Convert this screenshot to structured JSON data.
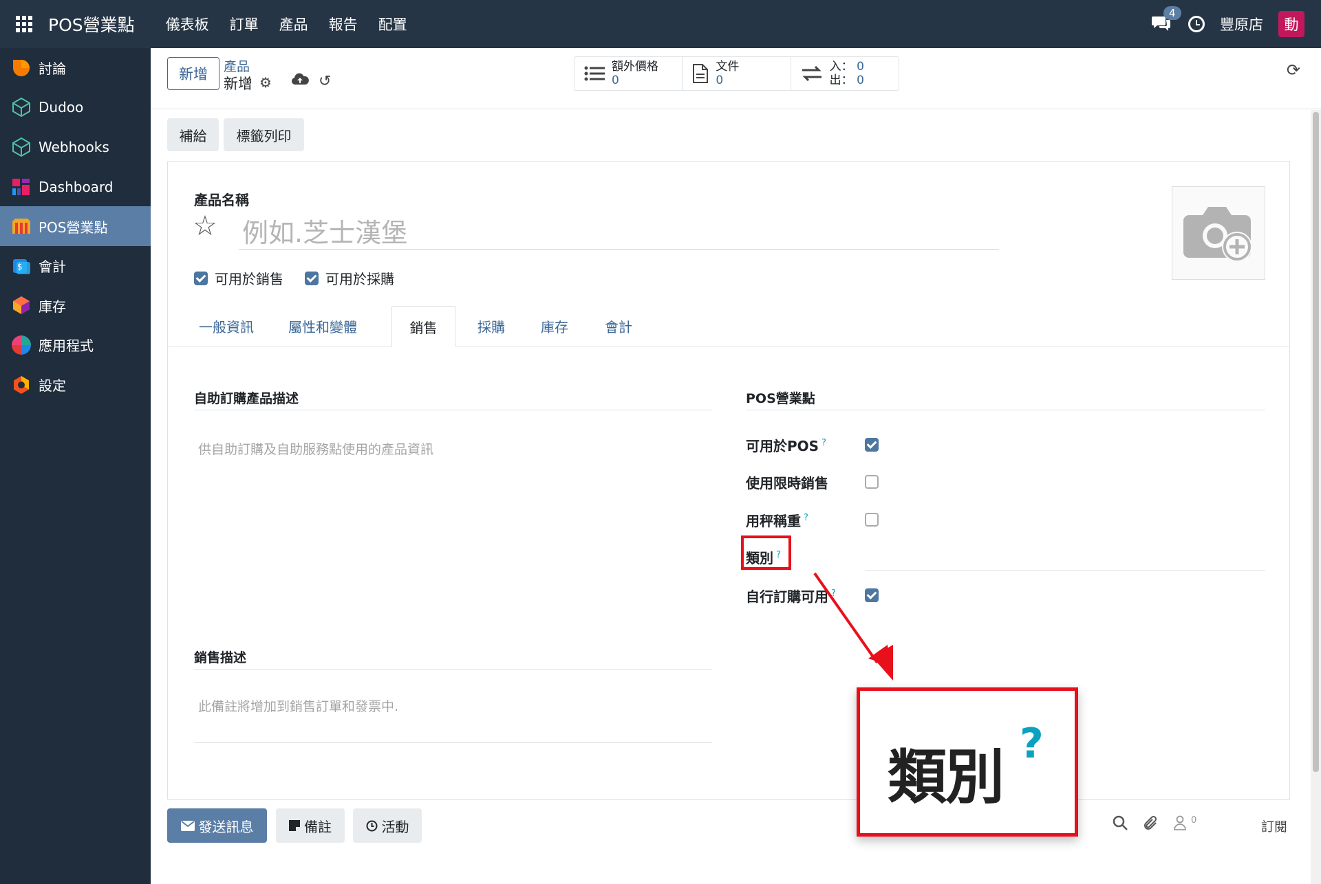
{
  "topbar": {
    "brand": "POS營業點",
    "menu": [
      "儀表板",
      "訂單",
      "產品",
      "報告",
      "配置"
    ],
    "chat_count": "4",
    "company": "豐原店",
    "avatar_initial": "動"
  },
  "sidebar": {
    "items": [
      {
        "label": "討論",
        "icon": "discuss-icon"
      },
      {
        "label": "Dudoo",
        "icon": "cube-icon"
      },
      {
        "label": "Webhooks",
        "icon": "cube-icon"
      },
      {
        "label": "Dashboard",
        "icon": "dashboard-icon"
      },
      {
        "label": "POS營業點",
        "icon": "pos-icon"
      },
      {
        "label": "會計",
        "icon": "accounting-icon"
      },
      {
        "label": "庫存",
        "icon": "inventory-icon"
      },
      {
        "label": "應用程式",
        "icon": "apps-icon"
      },
      {
        "label": "設定",
        "icon": "settings-icon"
      }
    ],
    "active": "POS營業點"
  },
  "control": {
    "new_label": "新增",
    "breadcrumb_parent": "產品",
    "breadcrumb_current": "新增",
    "stat_buttons": [
      {
        "label": "額外價格",
        "value": "0"
      },
      {
        "label": "文件",
        "value": "0"
      },
      {
        "in_label": "入：",
        "in_value": "0",
        "out_label": "出：",
        "out_value": "0"
      }
    ]
  },
  "actions": [
    "補給",
    "標籤列印"
  ],
  "form": {
    "name_label": "產品名稱",
    "name_placeholder": "例如.芝士漢堡",
    "can_sell_label": "可用於銷售",
    "can_purchase_label": "可用於採購",
    "tabs": [
      "一般資訊",
      "屬性和變體",
      "銷售",
      "採購",
      "庫存",
      "會計"
    ],
    "active_tab": "銷售",
    "self_order_section": "自助訂購產品描述",
    "self_order_placeholder": "供自助訂購及自助服務點使用的產品資訊",
    "sales_desc_section": "銷售描述",
    "sales_desc_placeholder": "此備註將增加到銷售訂單和發票中.",
    "pos_section": "POS營業點",
    "pos_fields": [
      {
        "label": "可用於POS",
        "help": "?",
        "checked": true
      },
      {
        "label": "使用限時銷售",
        "help": "",
        "checked": false
      },
      {
        "label": "用秤稱重",
        "help": "?",
        "checked": false
      },
      {
        "label": "類別",
        "help": "?",
        "checked": null
      },
      {
        "label": "自行訂購可用",
        "help": "?",
        "checked": true
      }
    ]
  },
  "chatter": {
    "send_message": "發送訊息",
    "log_note": "備註",
    "activity": "活動",
    "followers_count": "0",
    "subscribe": "訂閱"
  },
  "annotation": {
    "zoom_label": "類別",
    "zoom_help": "?",
    "color": "#e8101b"
  }
}
